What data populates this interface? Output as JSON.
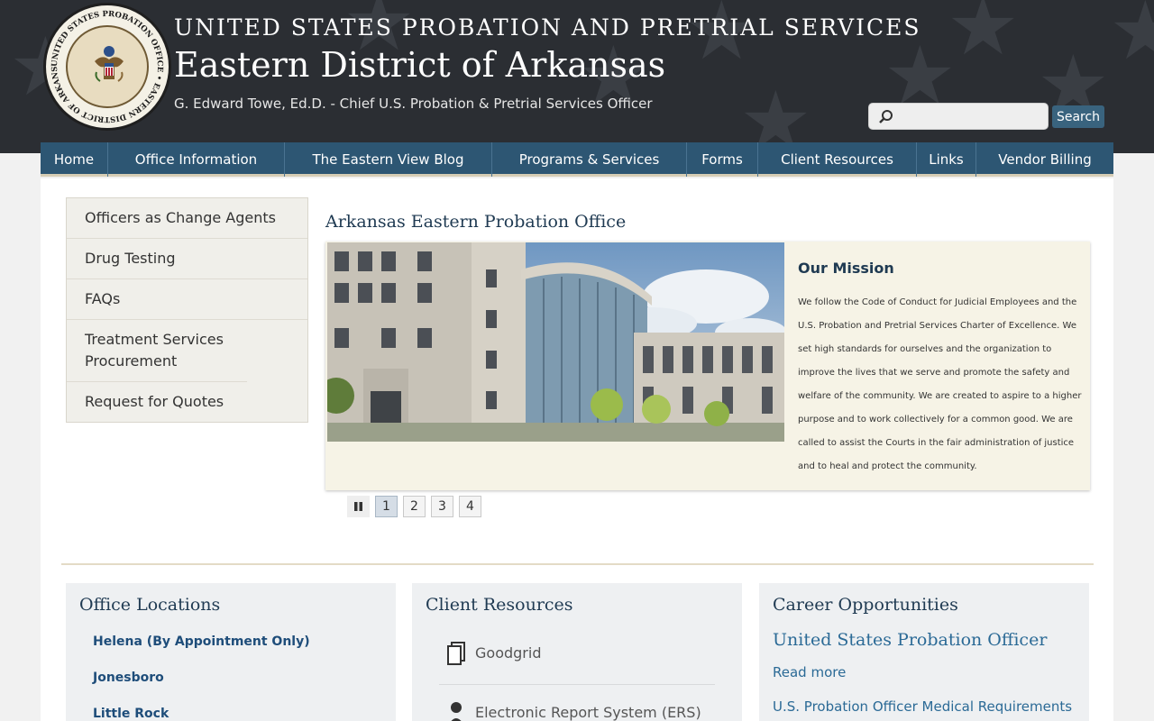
{
  "header": {
    "agency": "UNITED STATES PROBATION AND PRETRIAL SERVICES",
    "district": "Eastern District of Arkansas",
    "chief": "G. Edward Towe, Ed.D. - Chief U.S. Probation & Pretrial Services Officer",
    "seal_icon": "seal-icon",
    "seal_text": "UNITED STATES PROBATION OFFICE • EASTERN DISTRICT OF ARKANSAS"
  },
  "search": {
    "placeholder": "",
    "button_label": "Search",
    "icon": "search-icon"
  },
  "nav": {
    "items": [
      {
        "label": "Home"
      },
      {
        "label": "Office Information"
      },
      {
        "label": "The Eastern View Blog"
      },
      {
        "label": "Programs & Services"
      },
      {
        "label": "Forms"
      },
      {
        "label": "Client Resources"
      },
      {
        "label": "Links"
      },
      {
        "label": "Vendor Billing"
      }
    ]
  },
  "sidebar": {
    "items": [
      {
        "label": "Officers as Change Agents"
      },
      {
        "label": "Drug Testing"
      },
      {
        "label": "FAQs"
      },
      {
        "label": "Treatment Services Procurement"
      },
      {
        "label": "Request for Quotes"
      }
    ]
  },
  "main": {
    "title": "Arkansas Eastern Probation Office",
    "slide": {
      "mission_title": "Our Mission",
      "mission_text": "We follow the Code of Conduct for Judicial Employees and the U.S. Probation and Pretrial Services Charter of Excellence. We set high standards for ourselves and the organization to improve the lives that we serve and promote the safety and welfare of the community. We are created to aspire to a higher purpose and to work collectively for a common good. We are called to assist the Courts in the fair administration of justice and to heal and protect the community."
    },
    "pager": {
      "pause_icon": "pause-icon",
      "pages": [
        "1",
        "2",
        "3",
        "4"
      ],
      "active": "1"
    }
  },
  "cards": {
    "locations": {
      "title": "Office Locations",
      "items": [
        "Helena (By Appointment Only)",
        "Jonesboro",
        "Little Rock"
      ]
    },
    "client_resources": {
      "title": "Client Resources",
      "items": [
        {
          "label": "Goodgrid",
          "icon": "document-icon"
        },
        {
          "label": "Electronic Report System (ERS)",
          "icon": "person-icon"
        }
      ]
    },
    "careers": {
      "title": "Career Opportunities",
      "job_title": "United States Probation Officer",
      "read_more": "Read more",
      "medical": "U.S. Probation Officer Medical Requirements"
    }
  },
  "colors": {
    "header_bg": "#2b2e33",
    "nav_bg": "#2d5673",
    "title_text": "#1f3a52",
    "link": "#2b6a96",
    "slide_bg": "#f6f3e6",
    "search_button": "#39637e"
  }
}
